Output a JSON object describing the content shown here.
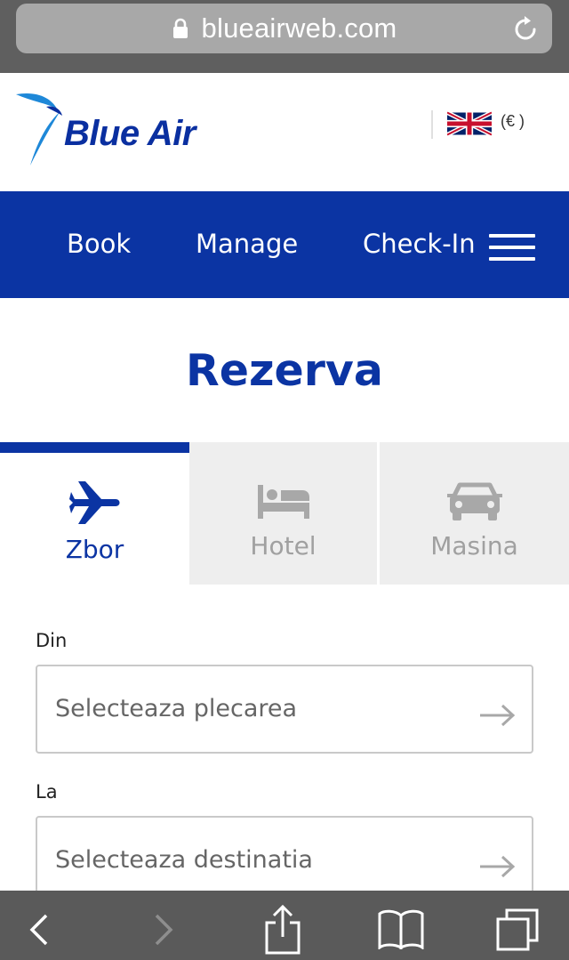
{
  "browser": {
    "url": "blueairweb.com",
    "icons": [
      "lock-icon",
      "reload-icon"
    ]
  },
  "header": {
    "logo_text": "Blue Air",
    "currency": "(€ )",
    "flag": "uk-flag-icon"
  },
  "nav": {
    "items": [
      "Book",
      "Manage",
      "Check-In"
    ],
    "menu_icon": "hamburger-menu-icon"
  },
  "page": {
    "title": "Rezerva"
  },
  "tabs": [
    {
      "label": "Zbor",
      "icon": "airplane-icon",
      "active": true
    },
    {
      "label": "Hotel",
      "icon": "bed-icon",
      "active": false
    },
    {
      "label": "Masina",
      "icon": "car-icon",
      "active": false
    }
  ],
  "form": {
    "from_label": "Din",
    "from_placeholder": "Selecteaza plecarea",
    "to_label": "La",
    "to_placeholder": "Selecteaza destinatia"
  },
  "toolbar": {
    "icons": [
      "back-icon",
      "forward-icon",
      "share-icon",
      "bookmarks-icon",
      "tabs-icon"
    ]
  },
  "colors": {
    "brand_blue": "#0b34a3",
    "tab_inactive": "#eeeeee",
    "inactive_icon": "#a0a0a0"
  }
}
